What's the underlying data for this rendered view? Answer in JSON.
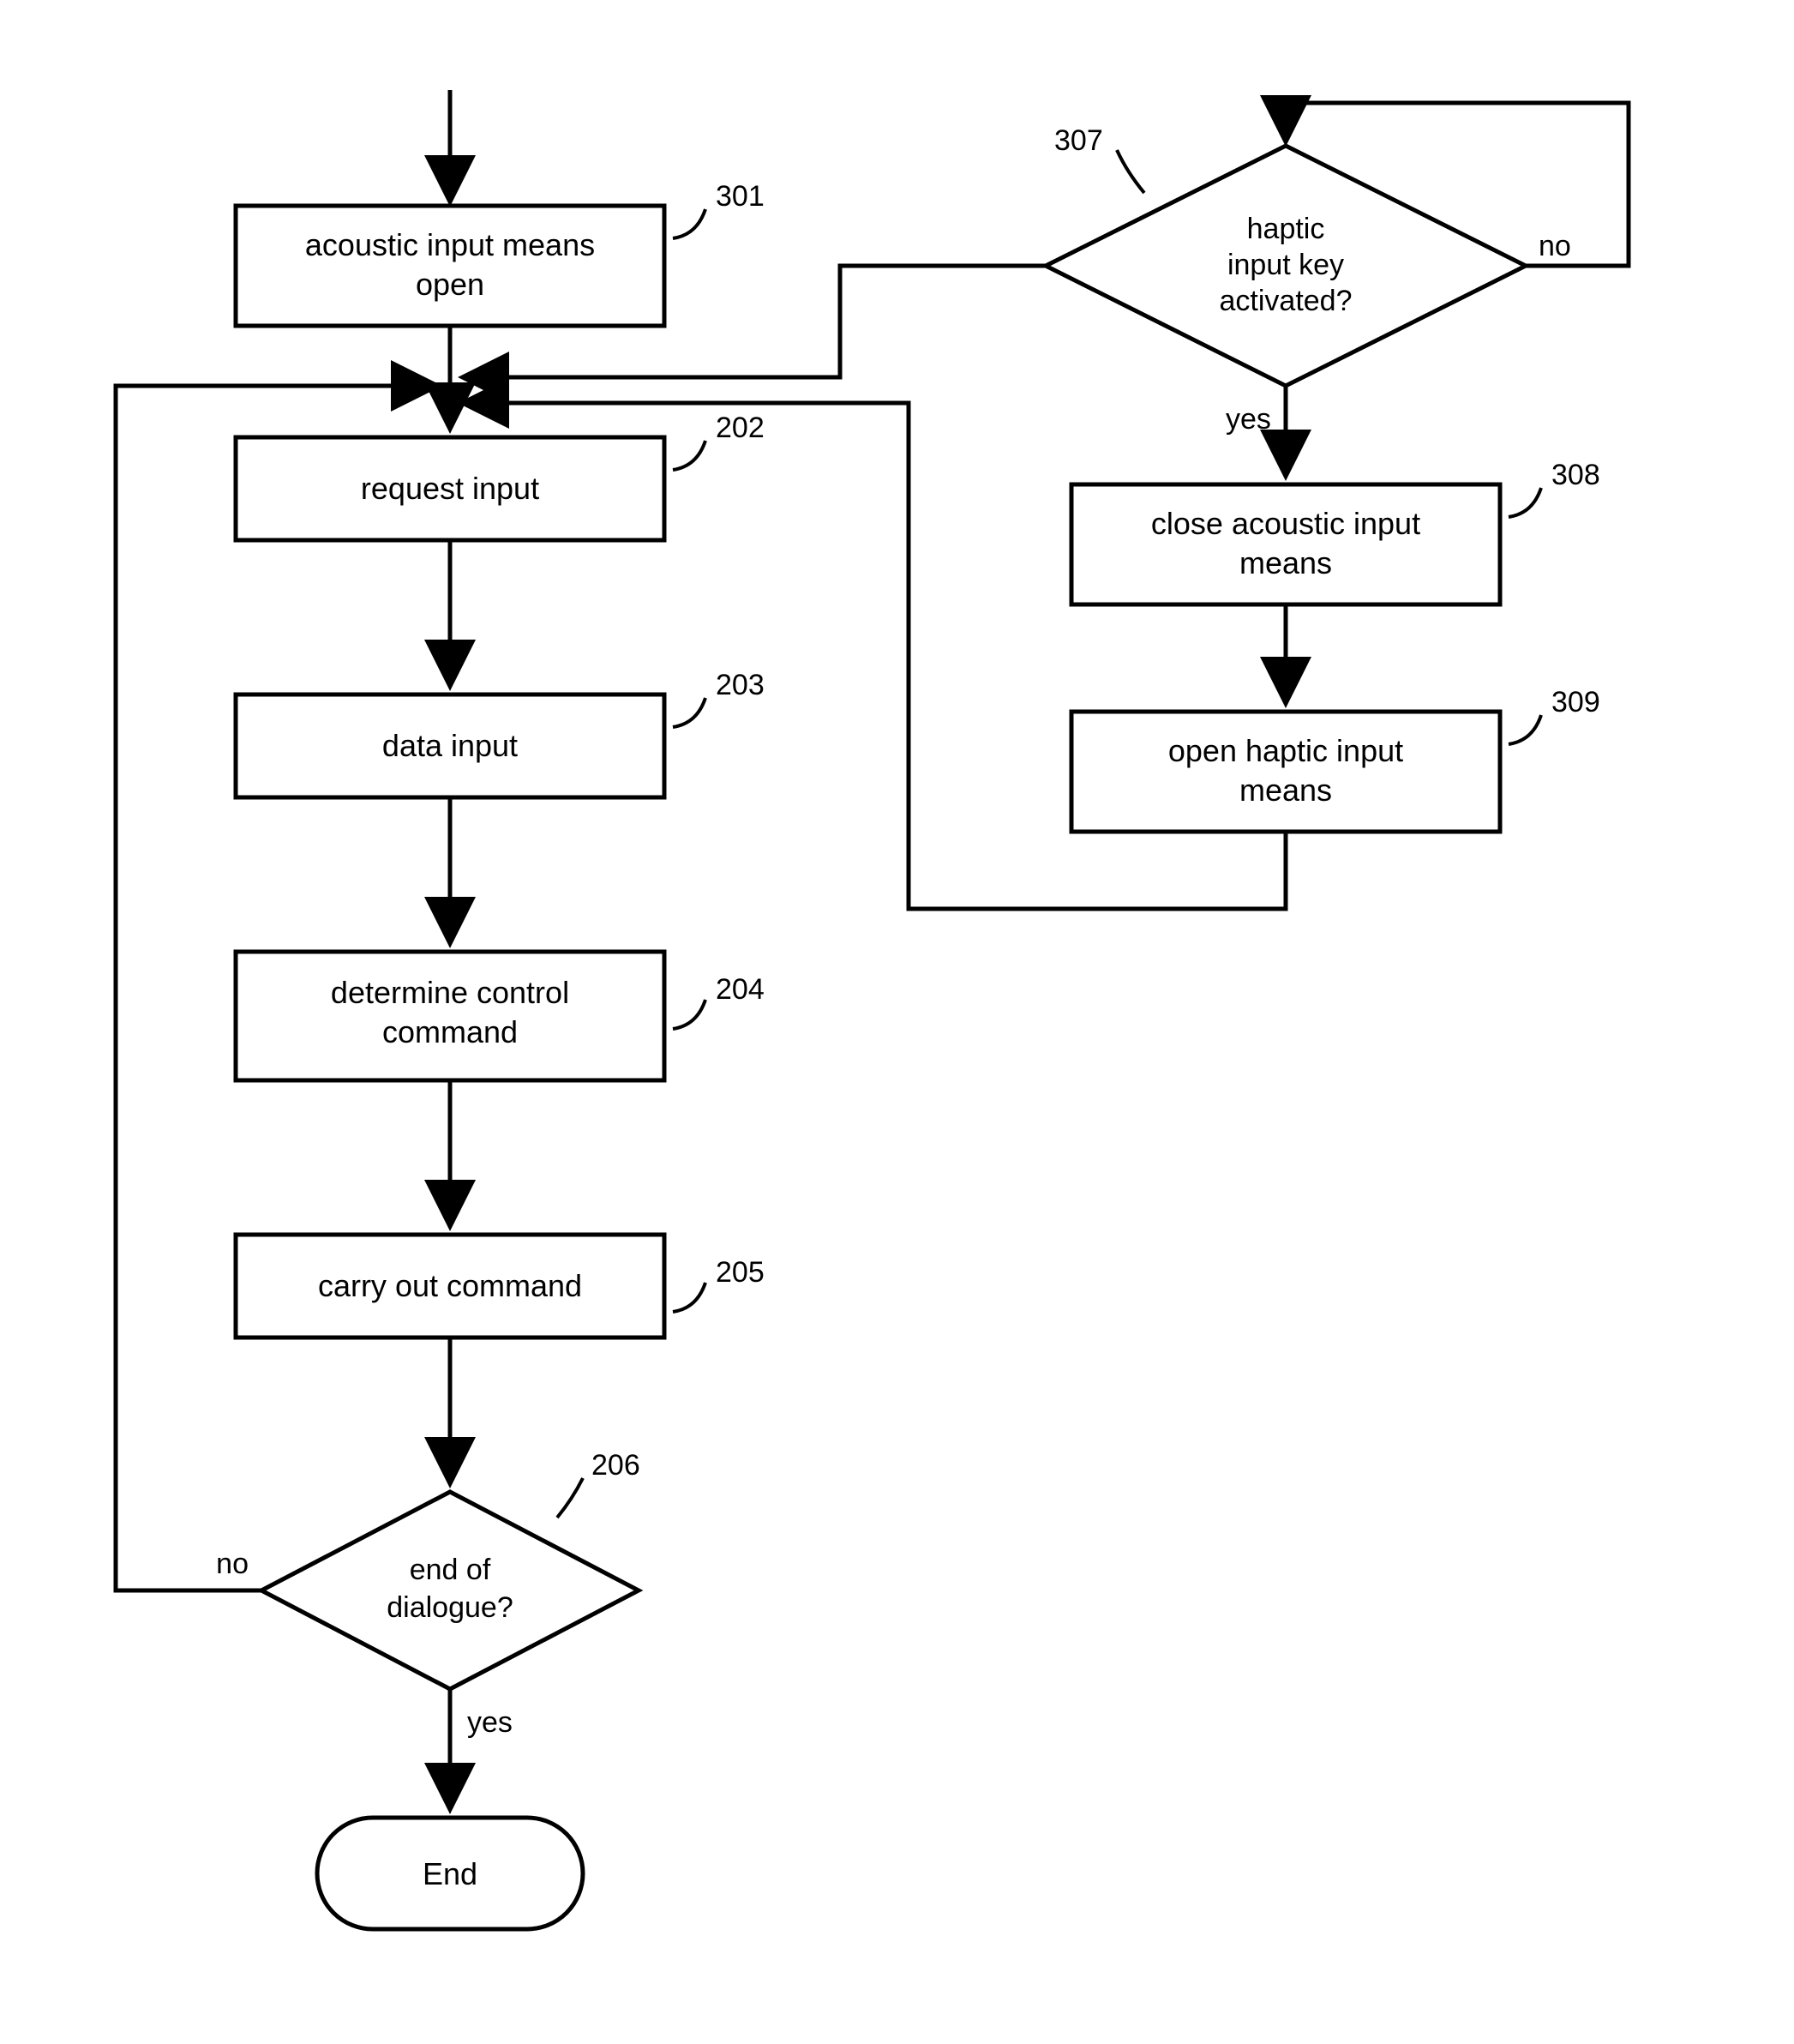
{
  "nodes": {
    "n301": {
      "label_l1": "acoustic input means",
      "label_l2": "open",
      "ref": "301"
    },
    "n202": {
      "label_l1": "request input",
      "ref": "202"
    },
    "n203": {
      "label_l1": "data input",
      "ref": "203"
    },
    "n204": {
      "label_l1": "determine control",
      "label_l2": "command",
      "ref": "204"
    },
    "n205": {
      "label_l1": "carry out command",
      "ref": "205"
    },
    "n308": {
      "label_l1": "close acoustic input",
      "label_l2": "means",
      "ref": "308"
    },
    "n309": {
      "label_l1": "open haptic input",
      "label_l2": "means",
      "ref": "309"
    },
    "end": {
      "label_l1": "End"
    }
  },
  "decisions": {
    "d206": {
      "l1": "end of",
      "l2": "dialogue?",
      "ref": "206",
      "yes": "yes",
      "no": "no"
    },
    "d307": {
      "l1": "haptic",
      "l2": "input key",
      "l3": "activated?",
      "ref": "307",
      "yes": "yes",
      "no": "no"
    }
  }
}
